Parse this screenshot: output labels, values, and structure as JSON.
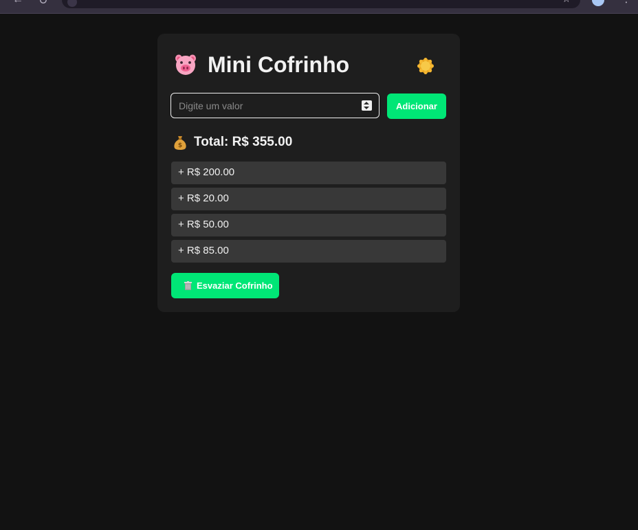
{
  "browser": {
    "nav_back_glyph": "←",
    "nav_reload_glyph": "↻",
    "bookmark_glyph": "☆",
    "menu_glyph": "⋮",
    "url": "",
    "icons": [
      "back-arrow-icon",
      "reload-icon",
      "site-info-icon",
      "bookmark-star-icon",
      "profile-avatar",
      "kebab-menu-icon"
    ]
  },
  "app": {
    "title": "Mini Cofrinho",
    "title_icon": "pig-icon",
    "theme_toggle_icon": "sun-icon"
  },
  "form": {
    "input_placeholder": "Digite um valor",
    "input_value": "",
    "add_label": "Adicionar",
    "accent_color": "#00e676"
  },
  "total": {
    "icon": "money-bag-icon",
    "text": "Total: R$ 355.00"
  },
  "entries": [
    "+ R$ 200.00",
    "+ R$ 20.00",
    "+ R$ 50.00",
    "+ R$ 85.00"
  ],
  "empty_button": {
    "icon": "trash-can-icon",
    "label": "Esvaziar Cofrinho"
  },
  "colors": {
    "page_background": "#121212",
    "card_background": "#1e1e1e",
    "entry_background": "#383838",
    "text": "#f2f2f2"
  }
}
